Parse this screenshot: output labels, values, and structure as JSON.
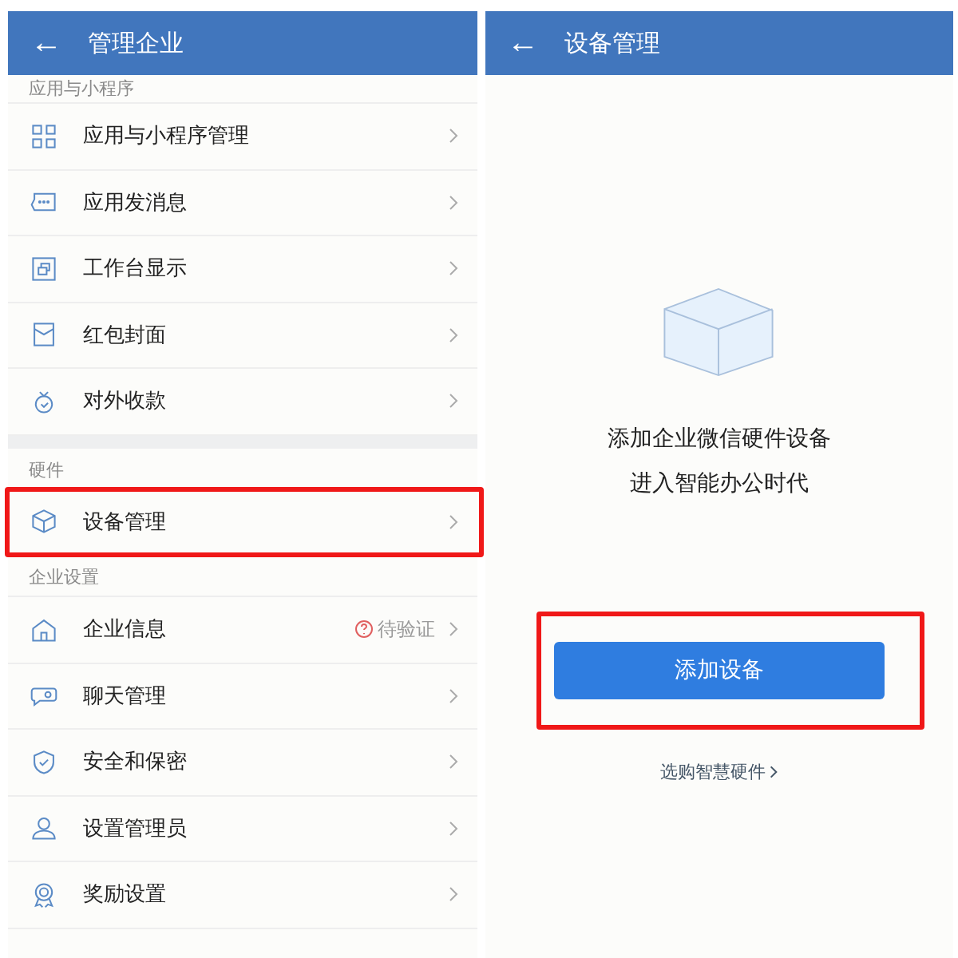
{
  "left_screen": {
    "title": "管理企业",
    "back_icon": "←",
    "sections": [
      {
        "label": "应用与小程序",
        "items": [
          {
            "label": "应用与小程序管理",
            "highlighted": false
          },
          {
            "label": "应用发消息",
            "highlighted": false
          },
          {
            "label": "工作台显示",
            "highlighted": false
          },
          {
            "label": "红包封面",
            "highlighted": false
          },
          {
            "label": "对外收款",
            "highlighted": false
          }
        ]
      },
      {
        "label": "硬件",
        "items": [
          {
            "label": "设备管理",
            "highlighted": true
          }
        ]
      },
      {
        "label": "企业设置",
        "items": [
          {
            "label": "企业信息",
            "status": "待验证",
            "highlighted": false
          },
          {
            "label": "聊天管理",
            "highlighted": false
          },
          {
            "label": "安全和保密",
            "highlighted": false
          },
          {
            "label": "设置管理员",
            "highlighted": false
          },
          {
            "label": "奖励设置",
            "highlighted": false
          }
        ]
      }
    ]
  },
  "right_screen": {
    "title": "设备管理",
    "back_icon": "←",
    "message_lines": [
      "添加企业微信硬件设备",
      "进入智能办公时代"
    ],
    "button": {
      "label": "添加设备",
      "highlighted": true
    },
    "link": "选购智慧硬件"
  }
}
